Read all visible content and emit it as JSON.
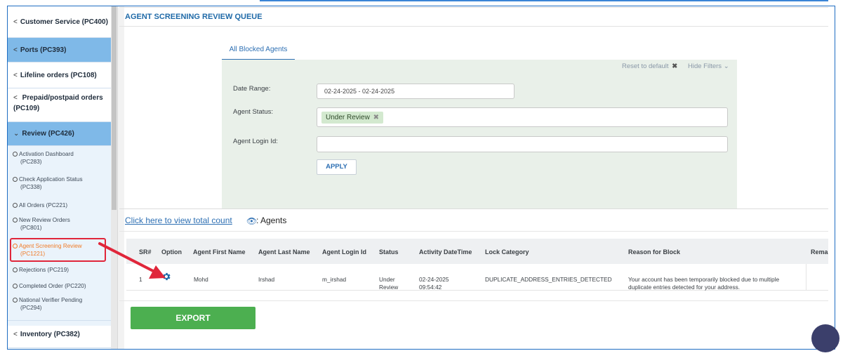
{
  "sidebar": {
    "items": [
      {
        "label": "Customer Service (PC400)"
      },
      {
        "label": "Ports (PC393)"
      },
      {
        "label": "Lifeline orders (PC108)"
      },
      {
        "label_line1": "Prepaid/postpaid orders",
        "label_line2": "(PC109)"
      },
      {
        "label": "Review (PC426)"
      },
      {
        "label": "Inventory (PC382)"
      }
    ],
    "sub_items": [
      {
        "line1": "Activation Dashboard",
        "line2": "(PC283)"
      },
      {
        "line1": "Check Application Status",
        "line2": "(PC338)"
      },
      {
        "line1": "All Orders (PC221)"
      },
      {
        "line1": "New Review Orders",
        "line2": "(PC801)"
      },
      {
        "line1": "Agent Screening Review",
        "line2": "(PC1221)"
      },
      {
        "line1": "Rejections (PC219)"
      },
      {
        "line1": "Completed Order (PC220)"
      },
      {
        "line1": "National Verifier Pending",
        "line2": "(PC294)"
      }
    ]
  },
  "page": {
    "title": "AGENT SCREENING REVIEW QUEUE",
    "tab_label": "All Blocked Agents"
  },
  "filters": {
    "reset_label": "Reset to default",
    "hide_label": "Hide Filters",
    "date_range_label": "Date Range:",
    "date_range_value": "02-24-2025 - 02-24-2025",
    "agent_status_label": "Agent Status:",
    "agent_status_chip": "Under Review",
    "agent_login_label": "Agent Login Id:",
    "agent_login_value": "",
    "apply_label": "APPLY"
  },
  "count": {
    "link_text": "Click here to view total count",
    "suffix": ": Agents"
  },
  "table": {
    "headers": [
      "SR#",
      "Option",
      "Agent First Name",
      "Agent Last Name",
      "Agent Login Id",
      "Status",
      "Activity DateTime",
      "Lock Category",
      "Reason for Block",
      "Rema"
    ],
    "rows": [
      {
        "sr": "1",
        "first_name": "Mohd",
        "last_name": "Irshad",
        "login_id": "m_irshad",
        "status_line1": "Under",
        "status_line2": "Review",
        "datetime_line1": "02-24-2025",
        "datetime_line2": "09:54:42",
        "lock_category": "DUPLICATE_ADDRESS_ENTRIES_DETECTED",
        "reason_line1": "Your account has been temporarily blocked due to multiple",
        "reason_line2": "duplicate entries detected for your address."
      }
    ]
  },
  "export_label": "EXPORT",
  "colors": {
    "nav_active": "#7fb9e8",
    "highlight_text": "#f07b26",
    "annotation_red": "#e0263a",
    "export_green": "#4caf50",
    "link_blue": "#2d6fb3"
  }
}
